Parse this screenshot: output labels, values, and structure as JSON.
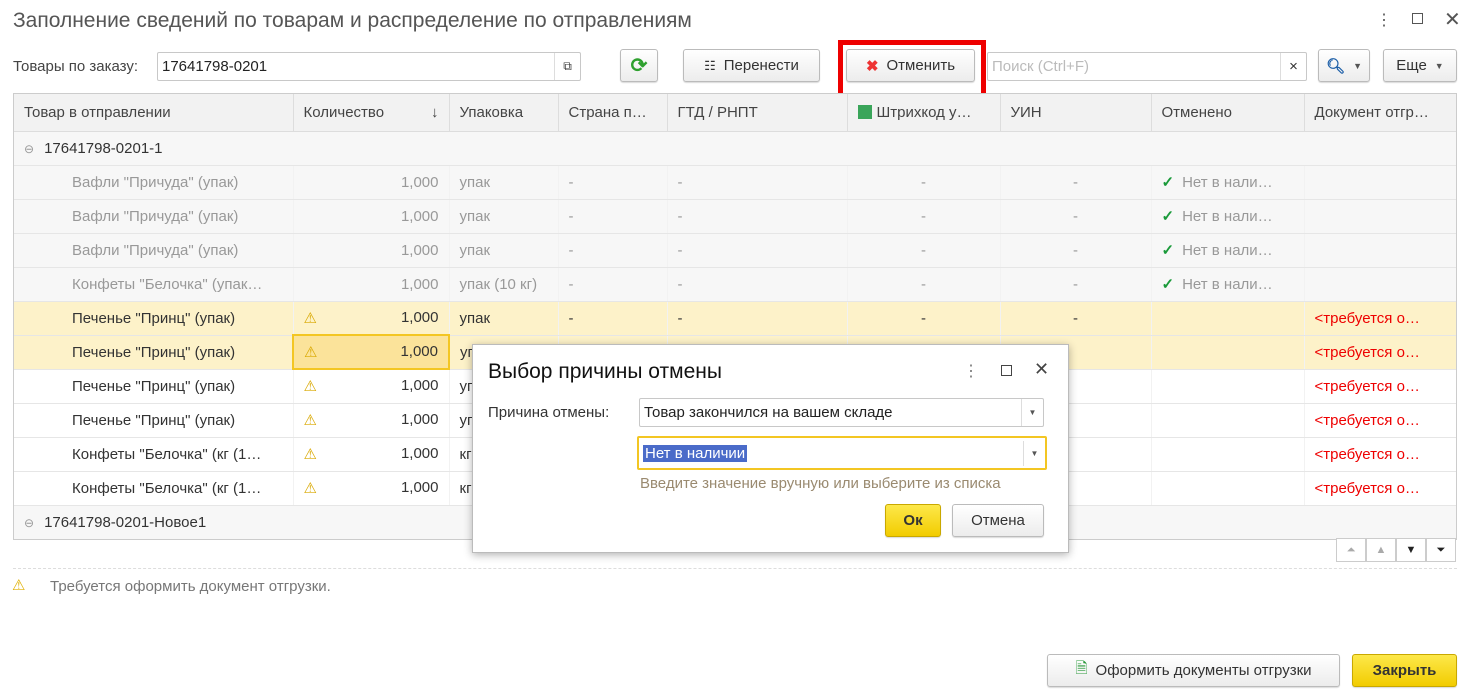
{
  "window": {
    "title": "Заполнение сведений по товарам и распределение по отправлениям"
  },
  "toolbar": {
    "order_label": "Товары по заказу:",
    "order_value": "17641798-0201",
    "move_label": "Перенести",
    "cancel_label": "Отменить",
    "search_placeholder": "Поиск (Ctrl+F)",
    "more_label": "Еще"
  },
  "table": {
    "columns": [
      "Товар в отправлении",
      "Количество",
      "Упаковка",
      "Страна п…",
      "ГТД / РНПТ",
      "Штрихкод у…",
      "УИН",
      "Отменено",
      "Документ отгр…"
    ],
    "groups": [
      "17641798-0201-1",
      "17641798-0201-Новое1"
    ],
    "rows": [
      {
        "name": "Вафли \"Причуда\" (упак)",
        "qty": "1,000",
        "pack": "упак",
        "country": "-",
        "gtd": "-",
        "barcode": "-",
        "uin": "-",
        "cancelled": "Нет в нали…",
        "doc": ""
      },
      {
        "name": "Вафли \"Причуда\" (упак)",
        "qty": "1,000",
        "pack": "упак",
        "country": "-",
        "gtd": "-",
        "barcode": "-",
        "uin": "-",
        "cancelled": "Нет в нали…",
        "doc": ""
      },
      {
        "name": "Вафли \"Причуда\" (упак)",
        "qty": "1,000",
        "pack": "упак",
        "country": "-",
        "gtd": "-",
        "barcode": "-",
        "uin": "-",
        "cancelled": "Нет в нали…",
        "doc": ""
      },
      {
        "name": "Конфеты \"Белочка\" (упак…",
        "qty": "1,000",
        "pack": "упак (10 кг)",
        "country": "-",
        "gtd": "-",
        "barcode": "-",
        "uin": "-",
        "cancelled": "Нет в нали…",
        "doc": ""
      },
      {
        "name": "Печенье \"Принц\" (упак)",
        "qty": "1,000",
        "pack": "упак",
        "country": "-",
        "gtd": "-",
        "barcode": "-",
        "uin": "-",
        "cancelled": "",
        "doc": "<требуется о…"
      },
      {
        "name": "Печенье \"Принц\" (упак)",
        "qty": "1,000",
        "pack": "уп",
        "country": "",
        "gtd": "",
        "barcode": "",
        "uin": "",
        "cancelled": "",
        "doc": "<требуется о…"
      },
      {
        "name": "Печенье \"Принц\" (упак)",
        "qty": "1,000",
        "pack": "уп",
        "country": "",
        "gtd": "",
        "barcode": "",
        "uin": "",
        "cancelled": "",
        "doc": "<требуется о…"
      },
      {
        "name": "Печенье \"Принц\" (упак)",
        "qty": "1,000",
        "pack": "уп",
        "country": "",
        "gtd": "",
        "barcode": "",
        "uin": "",
        "cancelled": "",
        "doc": "<требуется о…"
      },
      {
        "name": "Конфеты \"Белочка\" (кг (1…",
        "qty": "1,000",
        "pack": "кг",
        "country": "",
        "gtd": "",
        "barcode": "",
        "uin": "",
        "cancelled": "",
        "doc": "<требуется о…"
      },
      {
        "name": "Конфеты \"Белочка\" (кг (1…",
        "qty": "1,000",
        "pack": "кг",
        "country": "",
        "gtd": "",
        "barcode": "",
        "uin": "",
        "cancelled": "",
        "doc": "<требуется о…"
      }
    ]
  },
  "warning_text": "Требуется оформить документ отгрузки.",
  "dialog": {
    "title": "Выбор причины отмены",
    "reason_label": "Причина отмены:",
    "reason_value": "Товар закончился на вашем складе",
    "detail_value": "Нет в наличии",
    "hint": "Введите значение вручную или выберите из списка",
    "ok_label": "Ок",
    "cancel_label": "Отмена"
  },
  "footer": {
    "create_docs_label": "Оформить документы отгрузки",
    "close_label": "Закрыть"
  },
  "colors": {
    "accent_yellow": "#f5d000",
    "highlight_red": "#e00000",
    "warn_row": "#fdf2c9",
    "check_green": "#1a9a3a"
  }
}
